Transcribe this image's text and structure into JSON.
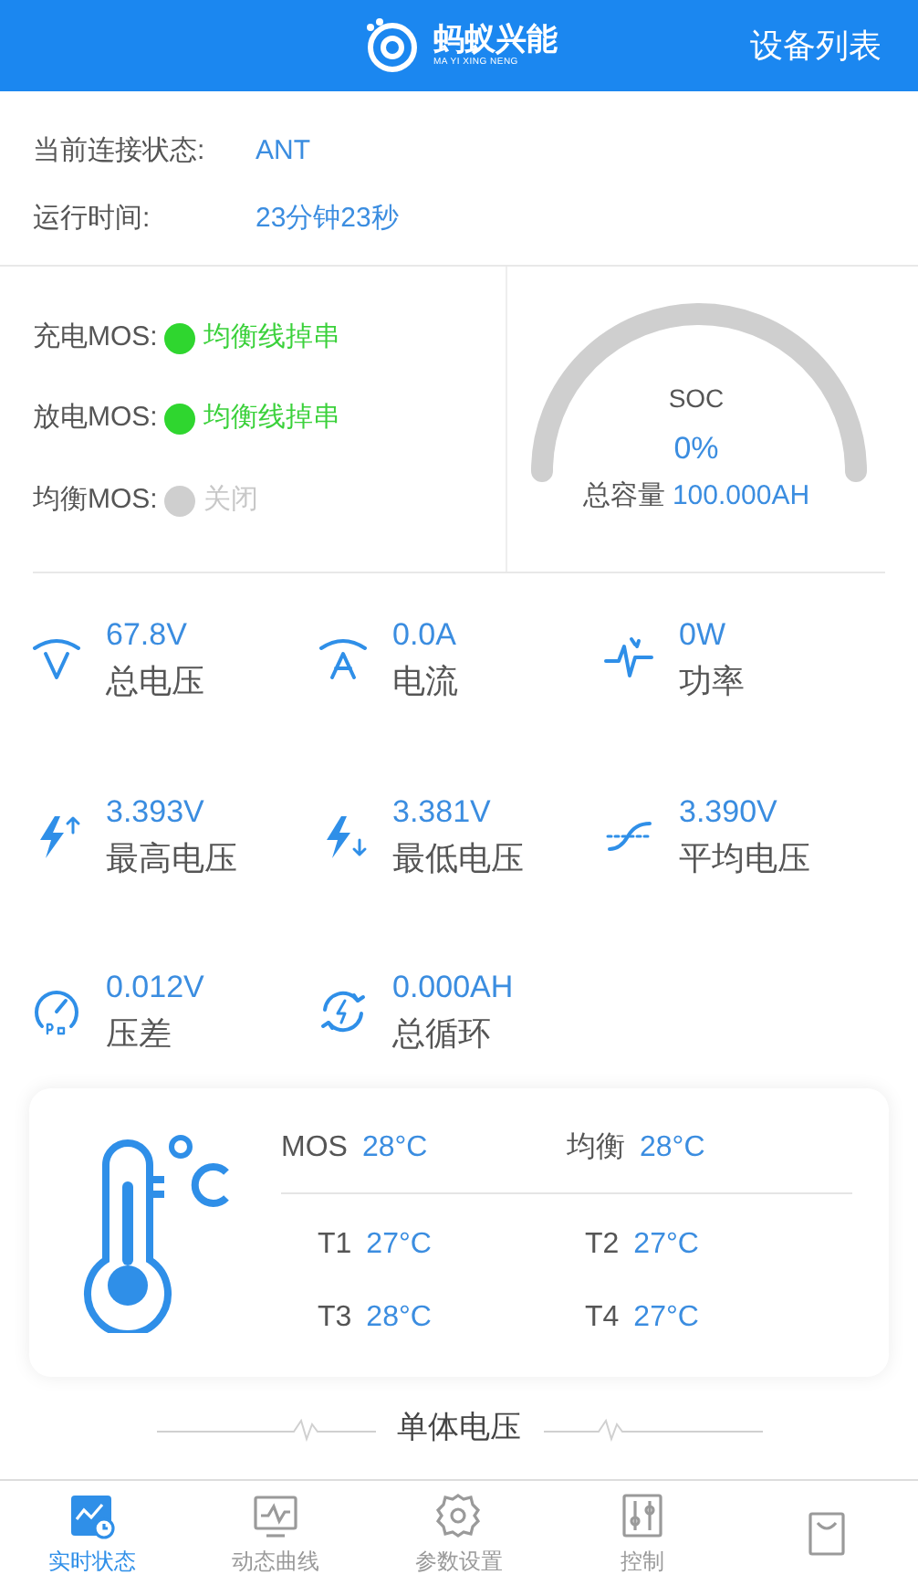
{
  "header": {
    "logo_text": "蚂蚁兴能",
    "logo_subtext": "MA YI XING NENG",
    "device_list": "设备列表"
  },
  "info": [
    {
      "label": "当前连接状态:",
      "value": "ANT"
    },
    {
      "label": "运行时间:",
      "value": "23分钟23秒"
    }
  ],
  "mos": [
    {
      "label": "充电MOS:",
      "status": "均衡线掉串",
      "on": true
    },
    {
      "label": "放电MOS:",
      "status": "均衡线掉串",
      "on": true
    },
    {
      "label": "均衡MOS:",
      "status": "关闭",
      "on": false
    }
  ],
  "soc": {
    "title": "SOC",
    "value": "0%",
    "capacity_label": "总容量",
    "capacity": "100.000AH"
  },
  "metrics": [
    {
      "kind": "volt",
      "value": "67.8V",
      "label": "总电压"
    },
    {
      "kind": "amp",
      "value": "0.0A",
      "label": "电流"
    },
    {
      "kind": "power",
      "value": "0W",
      "label": "功率"
    },
    {
      "kind": "max",
      "value": "3.393V",
      "label": "最高电压"
    },
    {
      "kind": "min",
      "value": "3.381V",
      "label": "最低电压"
    },
    {
      "kind": "avg",
      "value": "3.390V",
      "label": "平均电压"
    },
    {
      "kind": "diff",
      "value": "0.012V",
      "label": "压差"
    },
    {
      "kind": "cycle",
      "value": "0.000AH",
      "label": "总循环"
    }
  ],
  "temperature": {
    "top": [
      {
        "label": "MOS",
        "value": "28°C"
      },
      {
        "label": "均衡",
        "value": "28°C"
      }
    ],
    "sensors": [
      {
        "label": "T1",
        "value": "27°C"
      },
      {
        "label": "T2",
        "value": "27°C"
      },
      {
        "label": "T3",
        "value": "28°C"
      },
      {
        "label": "T4",
        "value": "27°C"
      }
    ]
  },
  "section_title": "单体电压",
  "tabs": [
    {
      "kind": "status",
      "label": "实时状态",
      "selected": true
    },
    {
      "kind": "curve",
      "label": "动态曲线",
      "selected": false
    },
    {
      "kind": "gear",
      "label": "参数设置",
      "selected": false
    },
    {
      "kind": "sliders",
      "label": "控制",
      "selected": false
    },
    {
      "kind": "bag",
      "selected": false
    }
  ]
}
